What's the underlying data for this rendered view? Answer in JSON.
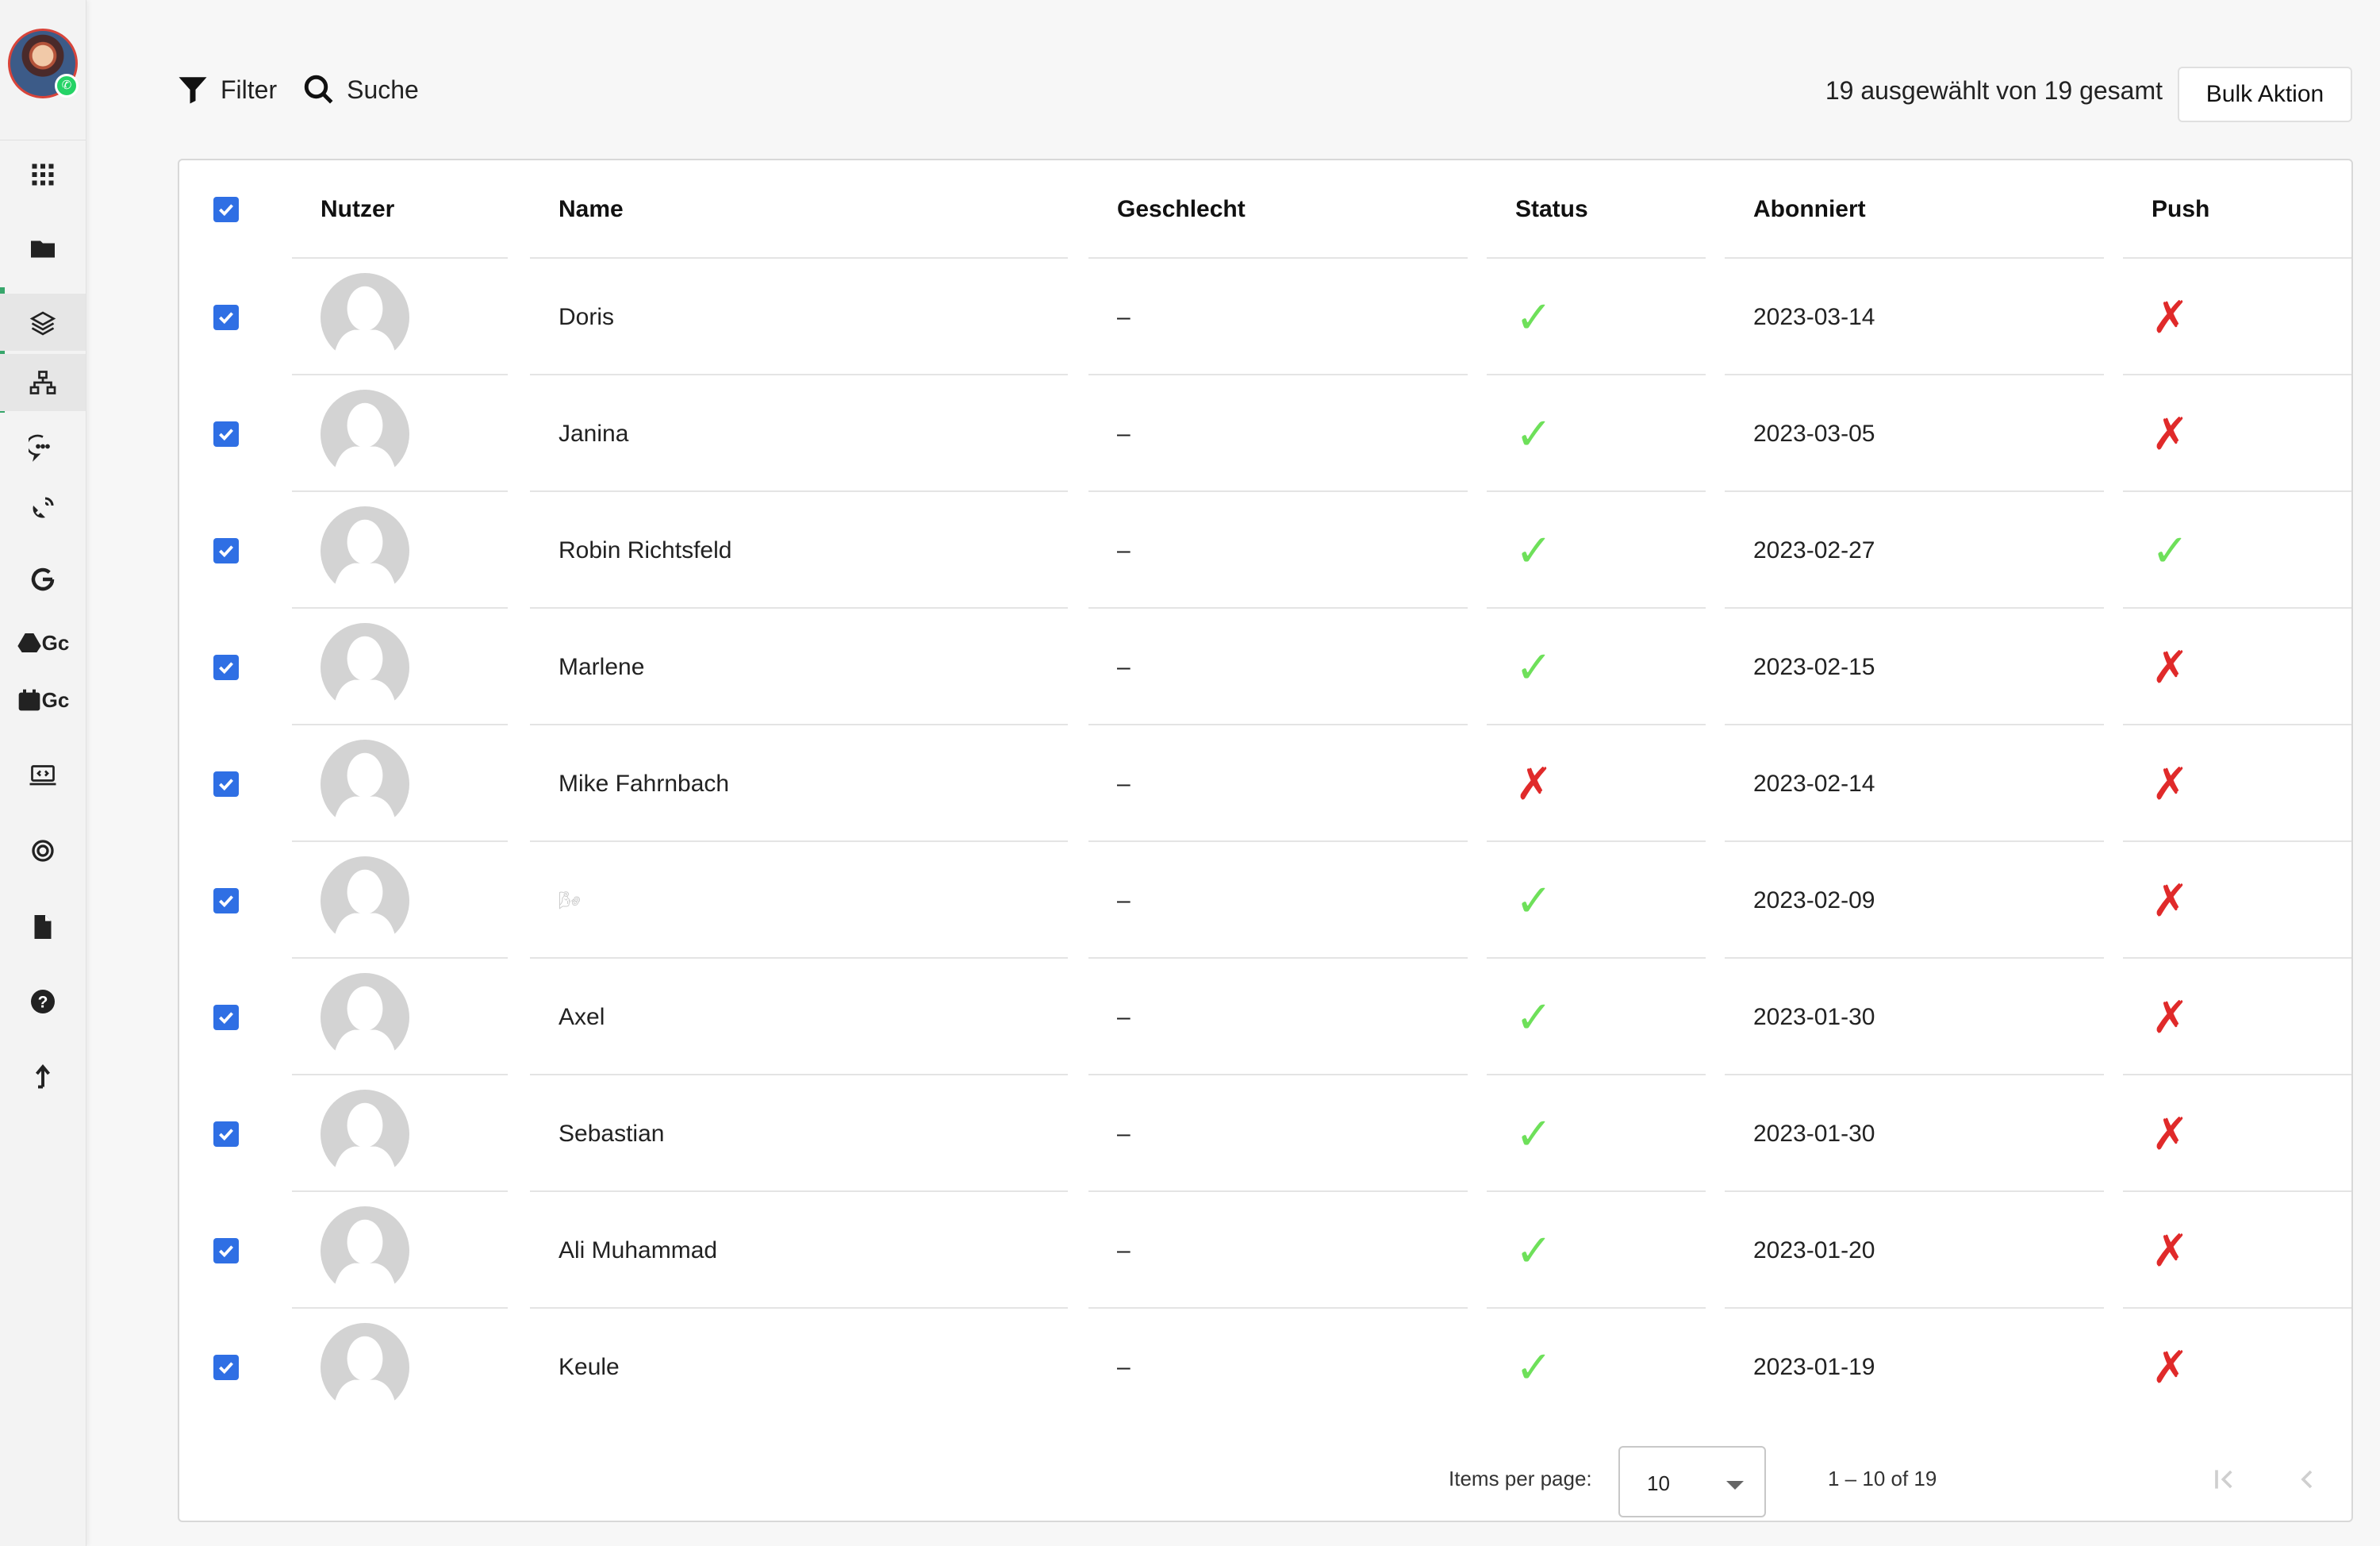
{
  "toolbar": {
    "filter_label": "Filter",
    "search_label": "Suche",
    "selection_info": "19 ausgewählt von 19 gesamt",
    "bulk_action_label": "Bulk Aktion"
  },
  "sidebar": {
    "items": [
      {
        "icon": "apps-grid-icon"
      },
      {
        "icon": "folder-icon"
      },
      {
        "icon": "layers-icon"
      },
      {
        "icon": "sitemap-icon"
      },
      {
        "icon": "chat-bubble-icon"
      },
      {
        "icon": "satellite-dish-icon"
      },
      {
        "icon": "google-icon"
      },
      {
        "icon": "google-drive-icon",
        "label": "Gc"
      },
      {
        "icon": "calendar-icon",
        "label": "Gc"
      },
      {
        "icon": "embed-code-icon"
      },
      {
        "icon": "lifebuoy-icon"
      },
      {
        "icon": "document-icon"
      },
      {
        "icon": "help-icon"
      },
      {
        "icon": "upload-arrow-icon"
      }
    ]
  },
  "table": {
    "columns": [
      "Nutzer",
      "Name",
      "Geschlecht",
      "Status",
      "Abonniert",
      "Push"
    ],
    "rows": [
      {
        "name": "Doris",
        "gender": "–",
        "status": "✓",
        "subscribed": "2023-03-14",
        "push": "✗"
      },
      {
        "name": "Janina",
        "gender": "–",
        "status": "✓",
        "subscribed": "2023-03-05",
        "push": "✗"
      },
      {
        "name": "Robin Richtsfeld",
        "gender": "–",
        "status": "✓",
        "subscribed": "2023-02-27",
        "push": "✓"
      },
      {
        "name": "Marlene",
        "gender": "–",
        "status": "✓",
        "subscribed": "2023-02-15",
        "push": "✗"
      },
      {
        "name": "Mike Fahrnbach",
        "gender": "–",
        "status": "✗",
        "subscribed": "2023-02-14",
        "push": "✗"
      },
      {
        "name": "🌬",
        "gender": "–",
        "status": "✓",
        "subscribed": "2023-02-09",
        "push": "✗"
      },
      {
        "name": "Axel",
        "gender": "–",
        "status": "✓",
        "subscribed": "2023-01-30",
        "push": "✗"
      },
      {
        "name": "Sebastian",
        "gender": "–",
        "status": "✓",
        "subscribed": "2023-01-30",
        "push": "✗"
      },
      {
        "name": "Ali Muhammad",
        "gender": "–",
        "status": "✓",
        "subscribed": "2023-01-20",
        "push": "✗"
      },
      {
        "name": "Keule",
        "gender": "–",
        "status": "✓",
        "subscribed": "2023-01-19",
        "push": "✗"
      }
    ]
  },
  "paginator": {
    "items_per_page_label": "Items per page:",
    "items_per_page_value": "10",
    "range_label": "1 – 10 of 19"
  },
  "colors": {
    "accent": "#37a66b",
    "checkbox": "#2f6fe4",
    "ok": "#6ee05a",
    "error": "#e02a2a"
  }
}
